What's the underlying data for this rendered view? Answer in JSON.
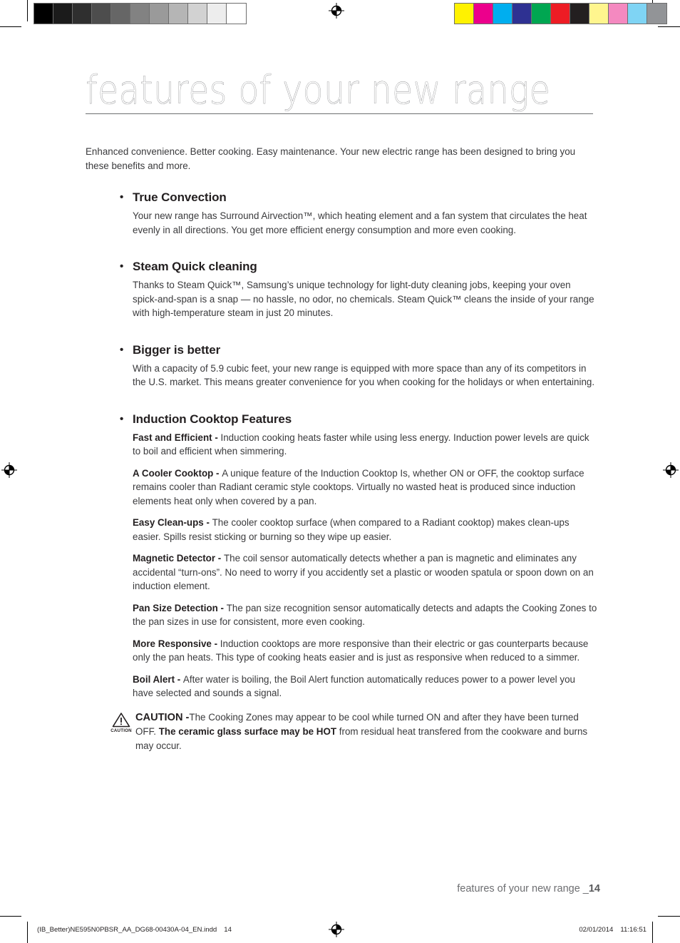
{
  "document": {
    "title": "features of your new range",
    "intro": "Enhanced convenience. Better cooking. Easy maintenance. Your new electric range has been designed to bring you these benefits and more."
  },
  "features": [
    {
      "heading": "True Convection",
      "bullet": "•",
      "paragraphs": [
        "Your new range has Surround Airvection™, which heating element and a fan system that circulates the heat evenly in all directions. You get more efficient energy consumption and more even cooking."
      ]
    },
    {
      "heading": "Steam Quick cleaning",
      "bullet": "•",
      "paragraphs": [
        "Thanks to Steam Quick™, Samsung’s unique technology for light-duty cleaning jobs, keeping your oven spick-and-span is a snap — no hassle, no odor, no chemicals. Steam Quick™ cleans the inside of your range with high-temperature steam in just 20 minutes."
      ]
    },
    {
      "heading": "Bigger is better",
      "bullet": "•",
      "paragraphs": [
        "With a capacity of 5.9 cubic feet, your new range is equipped with more space than any of its competitors in the U.S. market. This means greater convenience for you when cooking for the holidays or when entertaining."
      ]
    },
    {
      "heading": "Induction Cooktop Features",
      "bullet": "•",
      "items": [
        {
          "lead": "Fast and Efficient - ",
          "text": "Induction cooking heats faster while using less energy. Induction power levels are quick to boil and efficient when simmering."
        },
        {
          "lead": "A Cooler Cooktop - ",
          "text": "A unique feature of the Induction Cooktop Is, whether ON or OFF, the cooktop surface remains cooler than Radiant ceramic style cooktops. Virtually no wasted heat is produced since induction elements heat only when covered by a pan."
        },
        {
          "lead": "Easy Clean-ups - ",
          "text": "The cooler cooktop surface (when compared to a Radiant cooktop) makes clean-ups easier. Spills resist sticking or burning so they wipe up easier."
        },
        {
          "lead": "Magnetic Detector - ",
          "text": "The coil sensor automatically detects whether a pan is magnetic and eliminates any accidental “turn-ons”. No need to worry if you accidently set a plastic or wooden spatula or spoon down on an induction element."
        },
        {
          "lead": "Pan Size Detection - ",
          "text": "The pan size recognition sensor automatically detects and adapts the Cooking Zones to the pan sizes in use for consistent, more even cooking."
        },
        {
          "lead": "More Responsive - ",
          "text": "Induction cooktops are more responsive than their electric or gas counterparts because only the pan heats. This type of cooking heats easier and is just as responsive when reduced to a simmer."
        },
        {
          "lead": "Boil Alert - ",
          "text": "After water is boiling, the Boil Alert function automatically reduces power to a power level you have selected and sounds a signal."
        }
      ]
    }
  ],
  "caution": {
    "icon_label": "CAUTION",
    "lead": "CAUTION -",
    "text_before_bold": "The Cooking Zones may appear to be cool while turned ON and after they have been turned OFF. ",
    "bold_phrase": "The ceramic glass surface may be HOT",
    "text_after_bold": " from residual heat transfered from the cookware and burns may occur."
  },
  "footer": {
    "chapter_label": "features of your new range _",
    "page_number": "14",
    "slug_filename": "(IB_Better)NE595N0PBSR_AA_DG68-00430A-04_EN.indd",
    "slug_sequence": "14",
    "slug_date": "02/01/2014",
    "slug_time": "11:16:51"
  },
  "print_marks": {
    "grayscale_patches": [
      "#000000",
      "#1b1b1b",
      "#2f2f2f",
      "#4d4d4d",
      "#666666",
      "#828282",
      "#9a9a9a",
      "#b5b5b5",
      "#d2d2d2",
      "#ededed",
      "#ffffff"
    ],
    "color_patches": [
      "#fff200",
      "#ec008c",
      "#00aeef",
      "#2e3192",
      "#00a651",
      "#ed1c24",
      "#231f20",
      "#fff58e",
      "#f489c0",
      "#7fd4f4",
      "#929497"
    ]
  }
}
